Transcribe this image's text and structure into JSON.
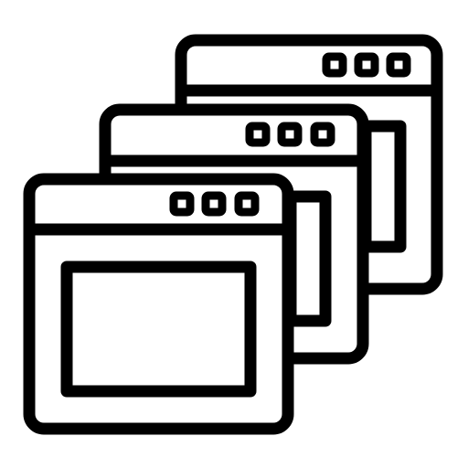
{
  "icon": {
    "name": "stacked-browser-windows-icon",
    "stroke_color": "#000000",
    "fill_color": "#ffffff",
    "window_count": 3,
    "dots_per_window": 3
  }
}
